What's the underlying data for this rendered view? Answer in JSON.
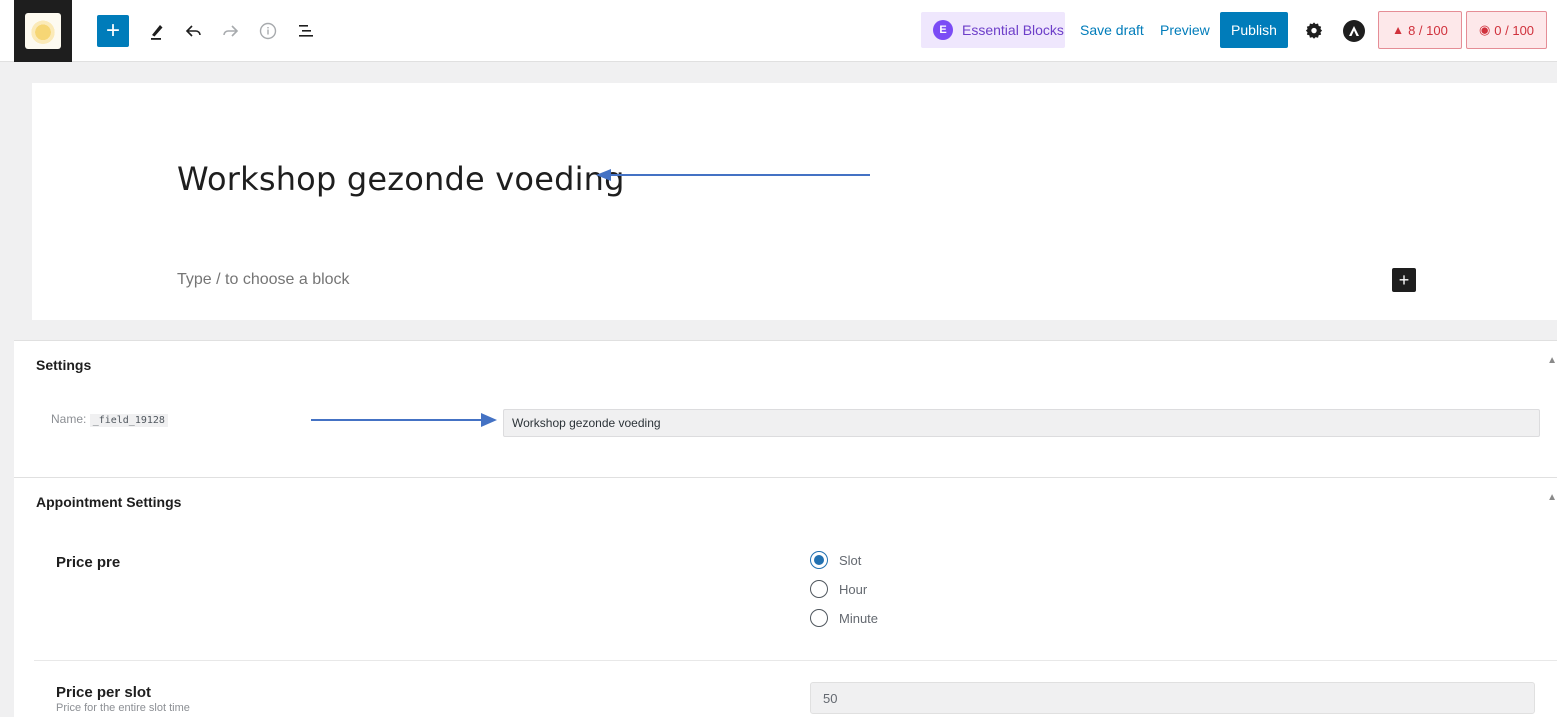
{
  "toolbar": {
    "inserter_icon": "plus-icon",
    "tools": [
      "pencil-icon",
      "undo-icon",
      "redo-icon",
      "info-icon",
      "list-view-icon"
    ],
    "essential_blocks_label": "Essential Blocks",
    "save_draft_label": "Save draft",
    "preview_label": "Preview",
    "publish_label": "Publish",
    "score_seo": "8 / 100",
    "score_readability": "0 / 100"
  },
  "editor": {
    "post_title": "Workshop gezonde voeding",
    "block_placeholder": "Type / to choose a block"
  },
  "settings_box": {
    "title": "Settings",
    "name_label": "Name:",
    "field_key": "_field_19128",
    "field_value": "Workshop gezonde voeding"
  },
  "appointment_box": {
    "title": "Appointment Settings",
    "price_pre_label": "Price pre",
    "options": [
      {
        "label": "Slot",
        "checked": true
      },
      {
        "label": "Hour",
        "checked": false
      },
      {
        "label": "Minute",
        "checked": false
      }
    ],
    "price_per_slot_label": "Price per slot",
    "price_per_slot_desc": "Price for the entire slot time",
    "price_per_slot_value": "50"
  },
  "colors": {
    "accent": "#007cba",
    "arrow": "#4472c4",
    "essential_blocks": "#6d3ec9",
    "score": "#d0313c"
  }
}
